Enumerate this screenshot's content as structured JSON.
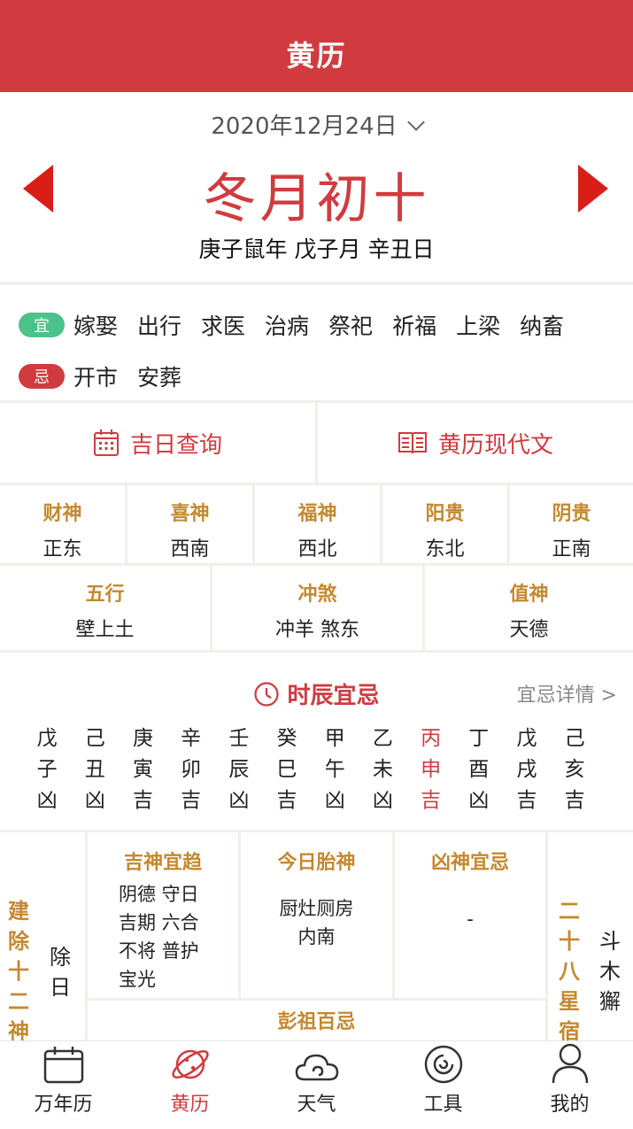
{
  "header": {
    "title": "黄历"
  },
  "date": {
    "solar": "2020年12月24日",
    "lunar": "冬月初十",
    "ganzhi": "庚子鼠年 戊子月 辛丑日"
  },
  "yi": {
    "tag": "宜",
    "items": [
      "嫁娶",
      "出行",
      "求医",
      "治病",
      "祭祀",
      "祈福",
      "上梁",
      "纳畜"
    ]
  },
  "ji": {
    "tag": "忌",
    "items": [
      "开市",
      "安葬"
    ]
  },
  "links": {
    "jiri": "吉日查询",
    "modern": "黄历现代文"
  },
  "gods": [
    {
      "label": "财神",
      "value": "正东"
    },
    {
      "label": "喜神",
      "value": "西南"
    },
    {
      "label": "福神",
      "value": "西北"
    },
    {
      "label": "阳贵",
      "value": "东北"
    },
    {
      "label": "阴贵",
      "value": "正南"
    }
  ],
  "info3": [
    {
      "label": "五行",
      "value": "壁上土"
    },
    {
      "label": "冲煞",
      "value": "冲羊 煞东"
    },
    {
      "label": "值神",
      "value": "天德"
    }
  ],
  "shichen": {
    "title": "时辰宜忌",
    "detail": "宜忌详情 >",
    "cols": [
      {
        "gan": "戊",
        "zhi": "子",
        "luck": "凶"
      },
      {
        "gan": "己",
        "zhi": "丑",
        "luck": "凶"
      },
      {
        "gan": "庚",
        "zhi": "寅",
        "luck": "吉"
      },
      {
        "gan": "辛",
        "zhi": "卯",
        "luck": "吉"
      },
      {
        "gan": "壬",
        "zhi": "辰",
        "luck": "凶"
      },
      {
        "gan": "癸",
        "zhi": "巳",
        "luck": "吉"
      },
      {
        "gan": "甲",
        "zhi": "午",
        "luck": "凶"
      },
      {
        "gan": "乙",
        "zhi": "未",
        "luck": "凶"
      },
      {
        "gan": "丙",
        "zhi": "申",
        "luck": "吉"
      },
      {
        "gan": "丁",
        "zhi": "酉",
        "luck": "凶"
      },
      {
        "gan": "戊",
        "zhi": "戌",
        "luck": "吉"
      },
      {
        "gan": "己",
        "zhi": "亥",
        "luck": "吉"
      }
    ]
  },
  "bottom": {
    "jianchu_label": [
      "建",
      "除",
      "十",
      "二",
      "神"
    ],
    "jianchu_value": [
      "除",
      "日"
    ],
    "jishen": {
      "title": "吉神宜趋",
      "lines": [
        "阴德 守日",
        "吉期 六合",
        "不将 普护",
        "宝光"
      ]
    },
    "taishen": {
      "title": "今日胎神",
      "lines": [
        "厨灶厕房",
        "内南"
      ]
    },
    "xiongshen": {
      "title": "凶神宜忌",
      "value": "-"
    },
    "xingxiu_label": [
      "二",
      "十",
      "八",
      "星",
      "宿"
    ],
    "xingxiu_value": [
      "斗",
      "木",
      "獬"
    ],
    "pengzu": "彭祖百忌"
  },
  "tabs": [
    {
      "label": "万年历",
      "icon": "calendar-icon"
    },
    {
      "label": "黄历",
      "icon": "planet-icon"
    },
    {
      "label": "天气",
      "icon": "cloud-icon"
    },
    {
      "label": "工具",
      "icon": "tool-icon"
    },
    {
      "label": "我的",
      "icon": "user-icon"
    }
  ],
  "active_tab": 1,
  "active_shichen": 8,
  "colors": {
    "primary": "#d13b3f",
    "gold": "#c4892f",
    "green": "#4cc28b"
  }
}
